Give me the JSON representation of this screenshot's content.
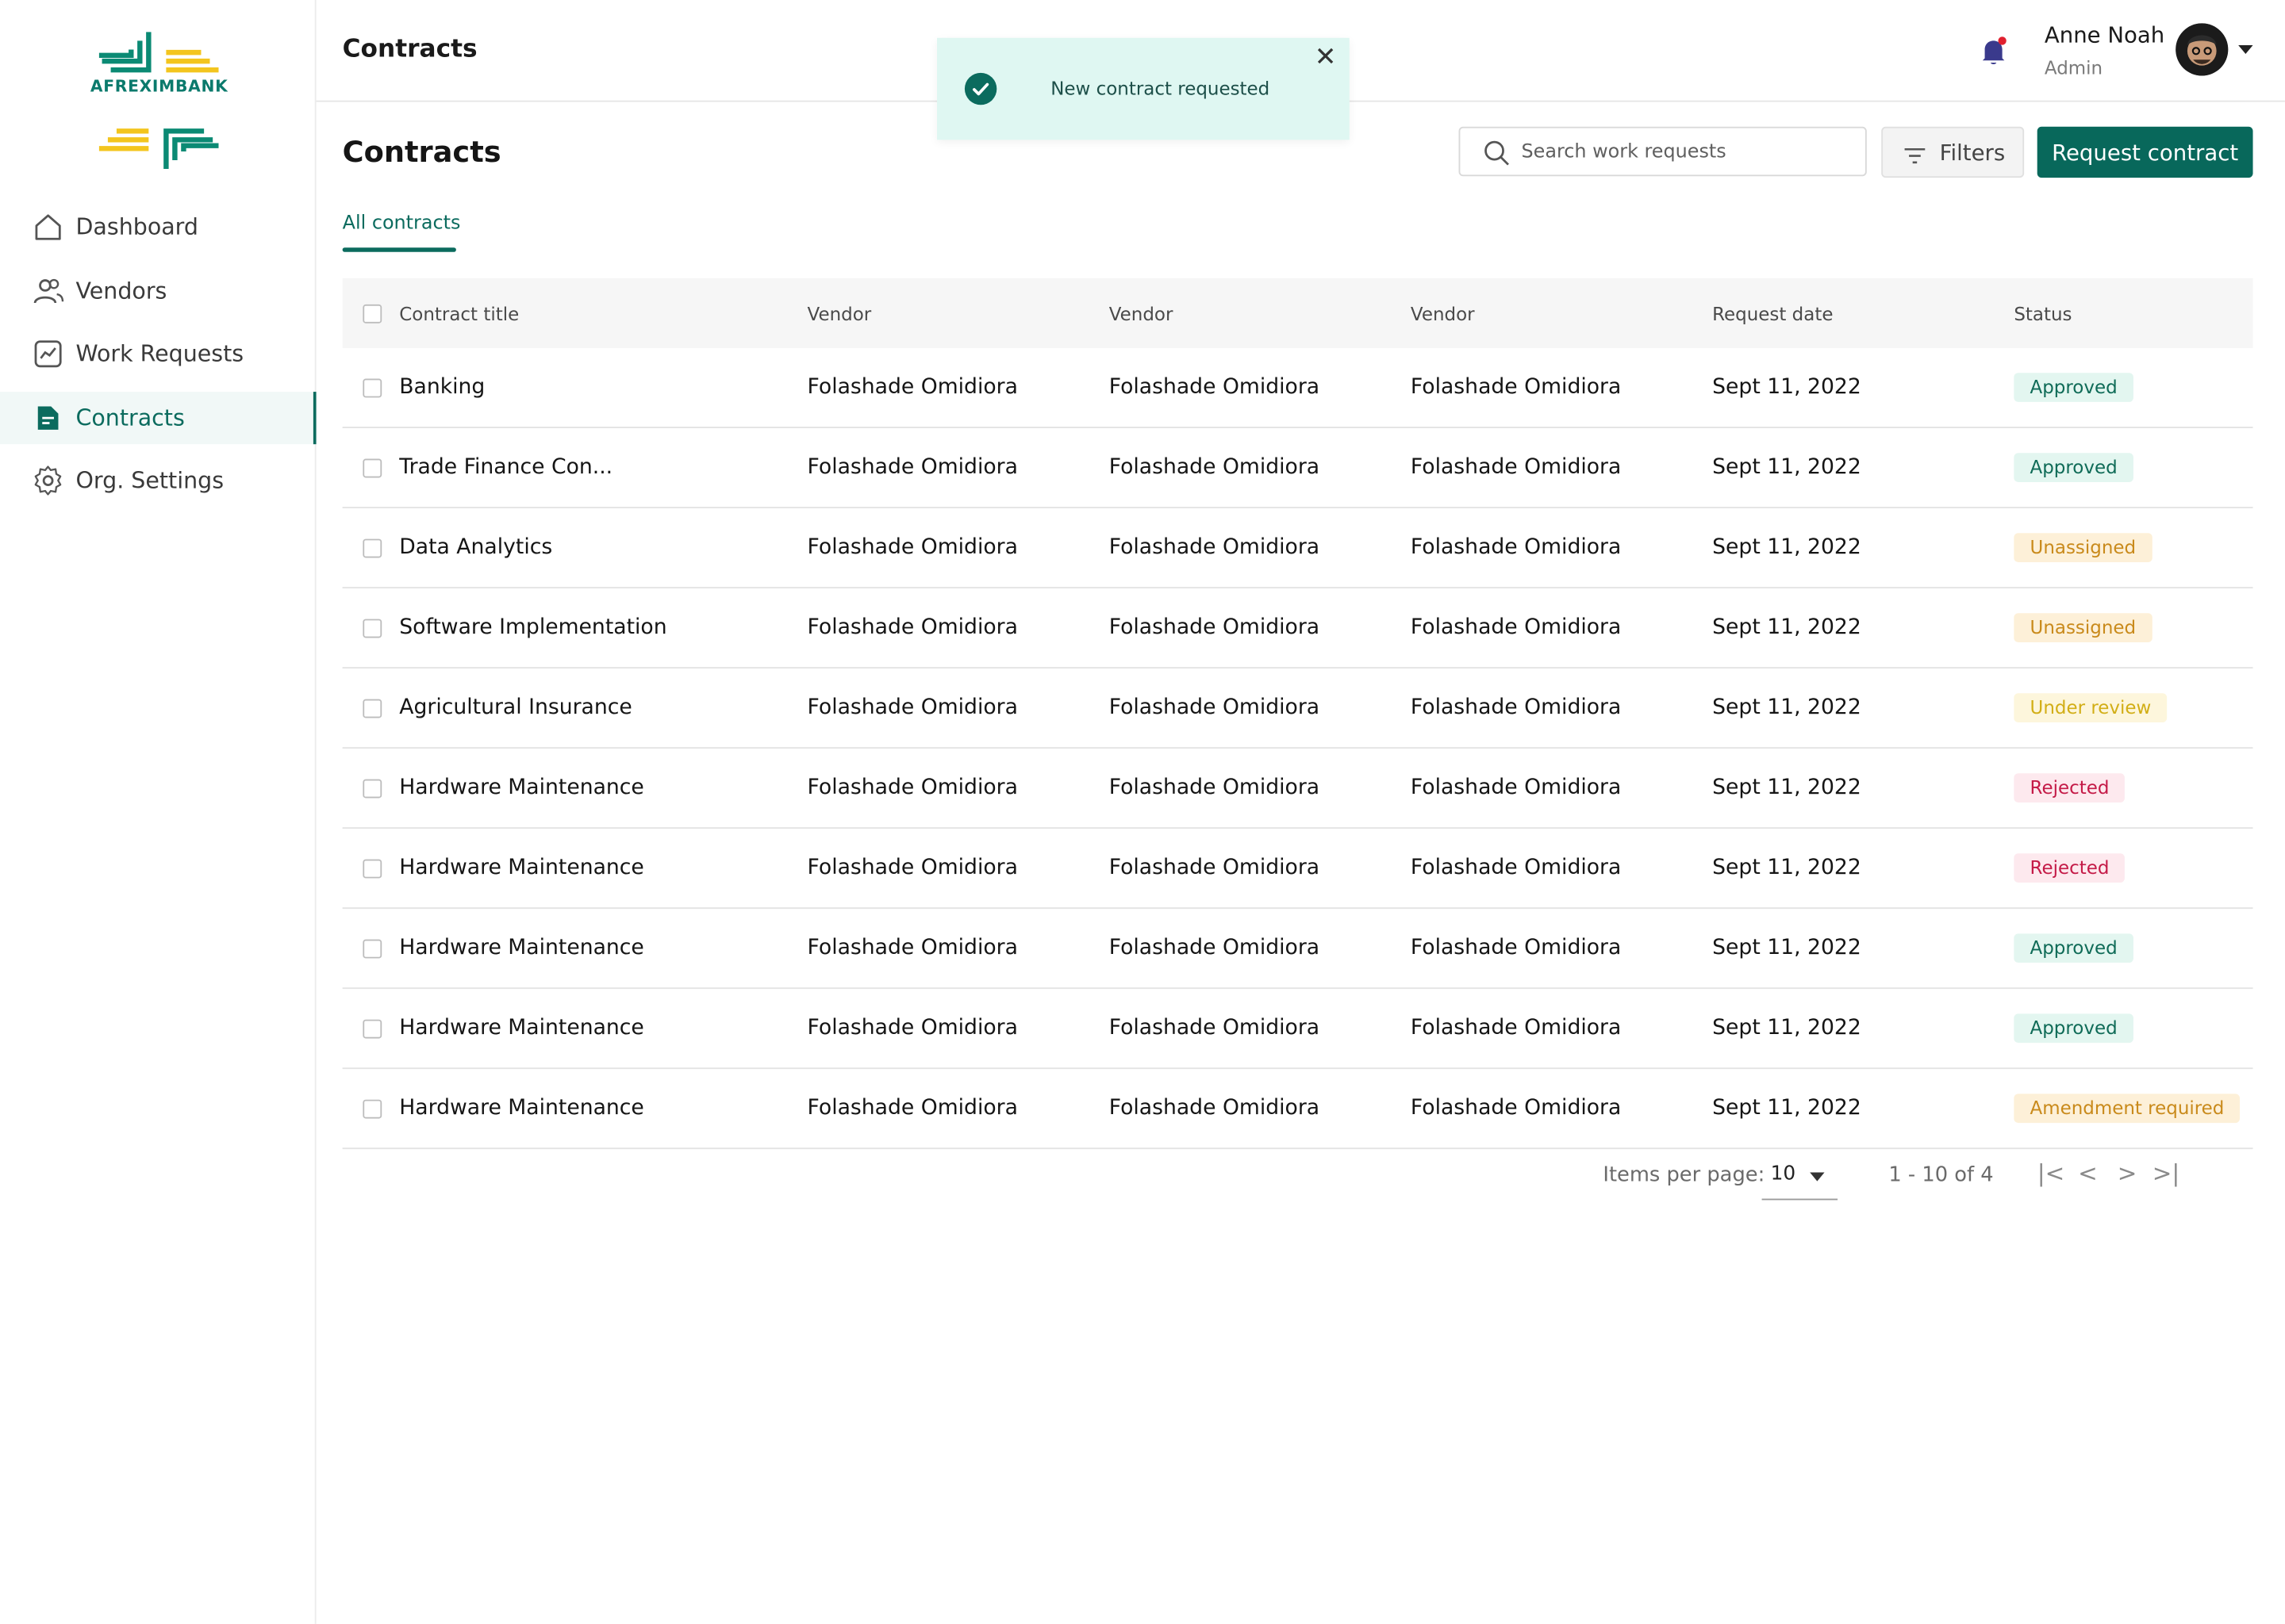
{
  "brand": {
    "name": "AFREXIMBANK",
    "accent": "#08685b"
  },
  "sidebar": {
    "items": [
      {
        "label": "Dashboard",
        "icon": "home-icon",
        "active": false
      },
      {
        "label": "Vendors",
        "icon": "users-icon",
        "active": false
      },
      {
        "label": "Work Requests",
        "icon": "chart-icon",
        "active": false
      },
      {
        "label": "Contracts",
        "icon": "document-icon",
        "active": true
      },
      {
        "label": "Org. Settings",
        "icon": "gear-icon",
        "active": false
      }
    ]
  },
  "header": {
    "title": "Contracts"
  },
  "user": {
    "name": "Anne Noah",
    "role": "Admin"
  },
  "toast": {
    "message": "New contract requested"
  },
  "page": {
    "title": "Contracts",
    "search_placeholder": "Search work requests",
    "filters_label": "Filters",
    "request_label": "Request contract",
    "tab_label": "All contracts"
  },
  "table": {
    "headers": [
      "Contract title",
      "Vendor",
      "Vendor",
      "Vendor",
      "Request date",
      "Status"
    ],
    "rows": [
      {
        "title": "Banking",
        "v1": "Folashade Omidiora",
        "v2": "Folashade Omidiora",
        "v3": "Folashade Omidiora",
        "date": "Sept 11, 2022",
        "status": "Approved",
        "kind": "approved"
      },
      {
        "title": "Trade Finance Con...",
        "v1": "Folashade Omidiora",
        "v2": "Folashade Omidiora",
        "v3": "Folashade Omidiora",
        "date": "Sept 11, 2022",
        "status": "Approved",
        "kind": "approved"
      },
      {
        "title": "Data Analytics",
        "v1": "Folashade Omidiora",
        "v2": "Folashade Omidiora",
        "v3": "Folashade Omidiora",
        "date": "Sept 11, 2022",
        "status": "Unassigned",
        "kind": "unassigned"
      },
      {
        "title": "Software Implementation",
        "v1": "Folashade Omidiora",
        "v2": "Folashade Omidiora",
        "v3": "Folashade Omidiora",
        "date": "Sept 11, 2022",
        "status": "Unassigned",
        "kind": "unassigned"
      },
      {
        "title": "Agricultural Insurance",
        "v1": "Folashade Omidiora",
        "v2": "Folashade Omidiora",
        "v3": "Folashade Omidiora",
        "date": "Sept 11, 2022",
        "status": "Under review",
        "kind": "review"
      },
      {
        "title": "Hardware Maintenance",
        "v1": "Folashade Omidiora",
        "v2": "Folashade Omidiora",
        "v3": "Folashade Omidiora",
        "date": "Sept 11, 2022",
        "status": "Rejected",
        "kind": "rejected"
      },
      {
        "title": "Hardware Maintenance",
        "v1": "Folashade Omidiora",
        "v2": "Folashade Omidiora",
        "v3": "Folashade Omidiora",
        "date": "Sept 11, 2022",
        "status": "Rejected",
        "kind": "rejected"
      },
      {
        "title": "Hardware Maintenance",
        "v1": "Folashade Omidiora",
        "v2": "Folashade Omidiora",
        "v3": "Folashade Omidiora",
        "date": "Sept 11, 2022",
        "status": "Approved",
        "kind": "approved"
      },
      {
        "title": "Hardware Maintenance",
        "v1": "Folashade Omidiora",
        "v2": "Folashade Omidiora",
        "v3": "Folashade Omidiora",
        "date": "Sept 11, 2022",
        "status": "Approved",
        "kind": "approved"
      },
      {
        "title": "Hardware Maintenance",
        "v1": "Folashade Omidiora",
        "v2": "Folashade Omidiora",
        "v3": "Folashade Omidiora",
        "date": "Sept 11, 2022",
        "status": "Amendment required",
        "kind": "amendment"
      }
    ]
  },
  "pagination": {
    "items_label": "Items per page:",
    "per_page": "10",
    "range": "1 - 10 of 4",
    "first": "|<",
    "prev": "<",
    "next": ">",
    "last": ">|"
  }
}
